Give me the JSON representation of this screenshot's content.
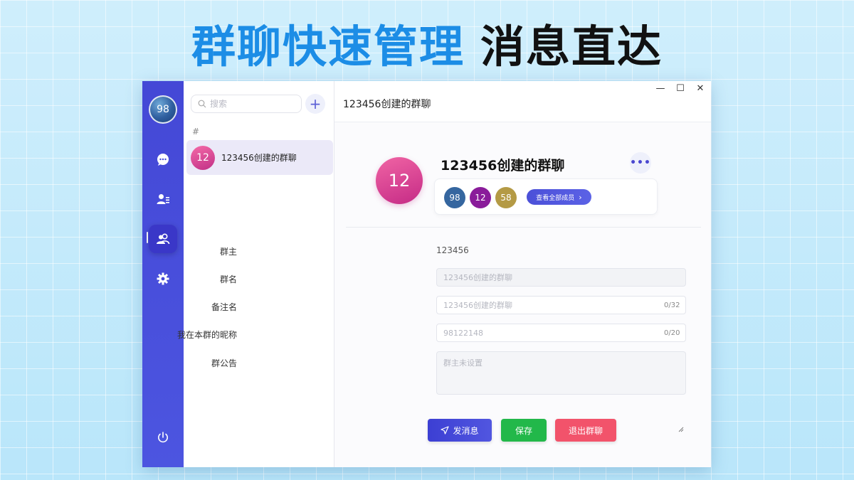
{
  "headline": {
    "blue": "群聊快速管理",
    "black": "消息直达"
  },
  "nav": {
    "me_avatar": "98",
    "items": [
      {
        "icon": "chat-bubble-icon"
      },
      {
        "icon": "contacts-icon"
      },
      {
        "icon": "group-icon",
        "active": true
      },
      {
        "icon": "gear-icon"
      }
    ],
    "power_icon": "power-icon"
  },
  "list": {
    "search_placeholder": "搜索",
    "add_label": "+",
    "section_header": "#",
    "items": [
      {
        "avatar": "12",
        "name": "123456创建的群聊",
        "selected": true
      }
    ]
  },
  "window": {
    "title": "123456创建的群聊",
    "controls": [
      "—",
      "☐",
      "✕"
    ]
  },
  "group": {
    "avatar": "12",
    "name": "123456创建的群聊",
    "more_label": "•••",
    "members": [
      {
        "label": "98",
        "color": "#35669f"
      },
      {
        "label": "12",
        "color": "#8a1c9a"
      },
      {
        "label": "58",
        "color": "#b49a45"
      }
    ],
    "view_all_label": "查看全部成员",
    "view_all_arrow": "›"
  },
  "form": {
    "owner_label": "群主",
    "owner_value": "123456",
    "name_label": "群名",
    "name_placeholder": "123456创建的群聊",
    "remark_label": "备注名",
    "remark_placeholder": "123456创建的群聊",
    "remark_counter": "0/32",
    "nickname_label": "我在本群的昵称",
    "nickname_placeholder": "98122148",
    "nickname_counter": "0/20",
    "notice_label": "群公告",
    "notice_placeholder": "群主未设置"
  },
  "actions": {
    "send": "发消息",
    "save": "保存",
    "quit": "退出群聊"
  },
  "colors": {
    "nav": "#4448d6",
    "accent": "#4b50d8",
    "save": "#22b84a",
    "quit": "#f2536b"
  }
}
